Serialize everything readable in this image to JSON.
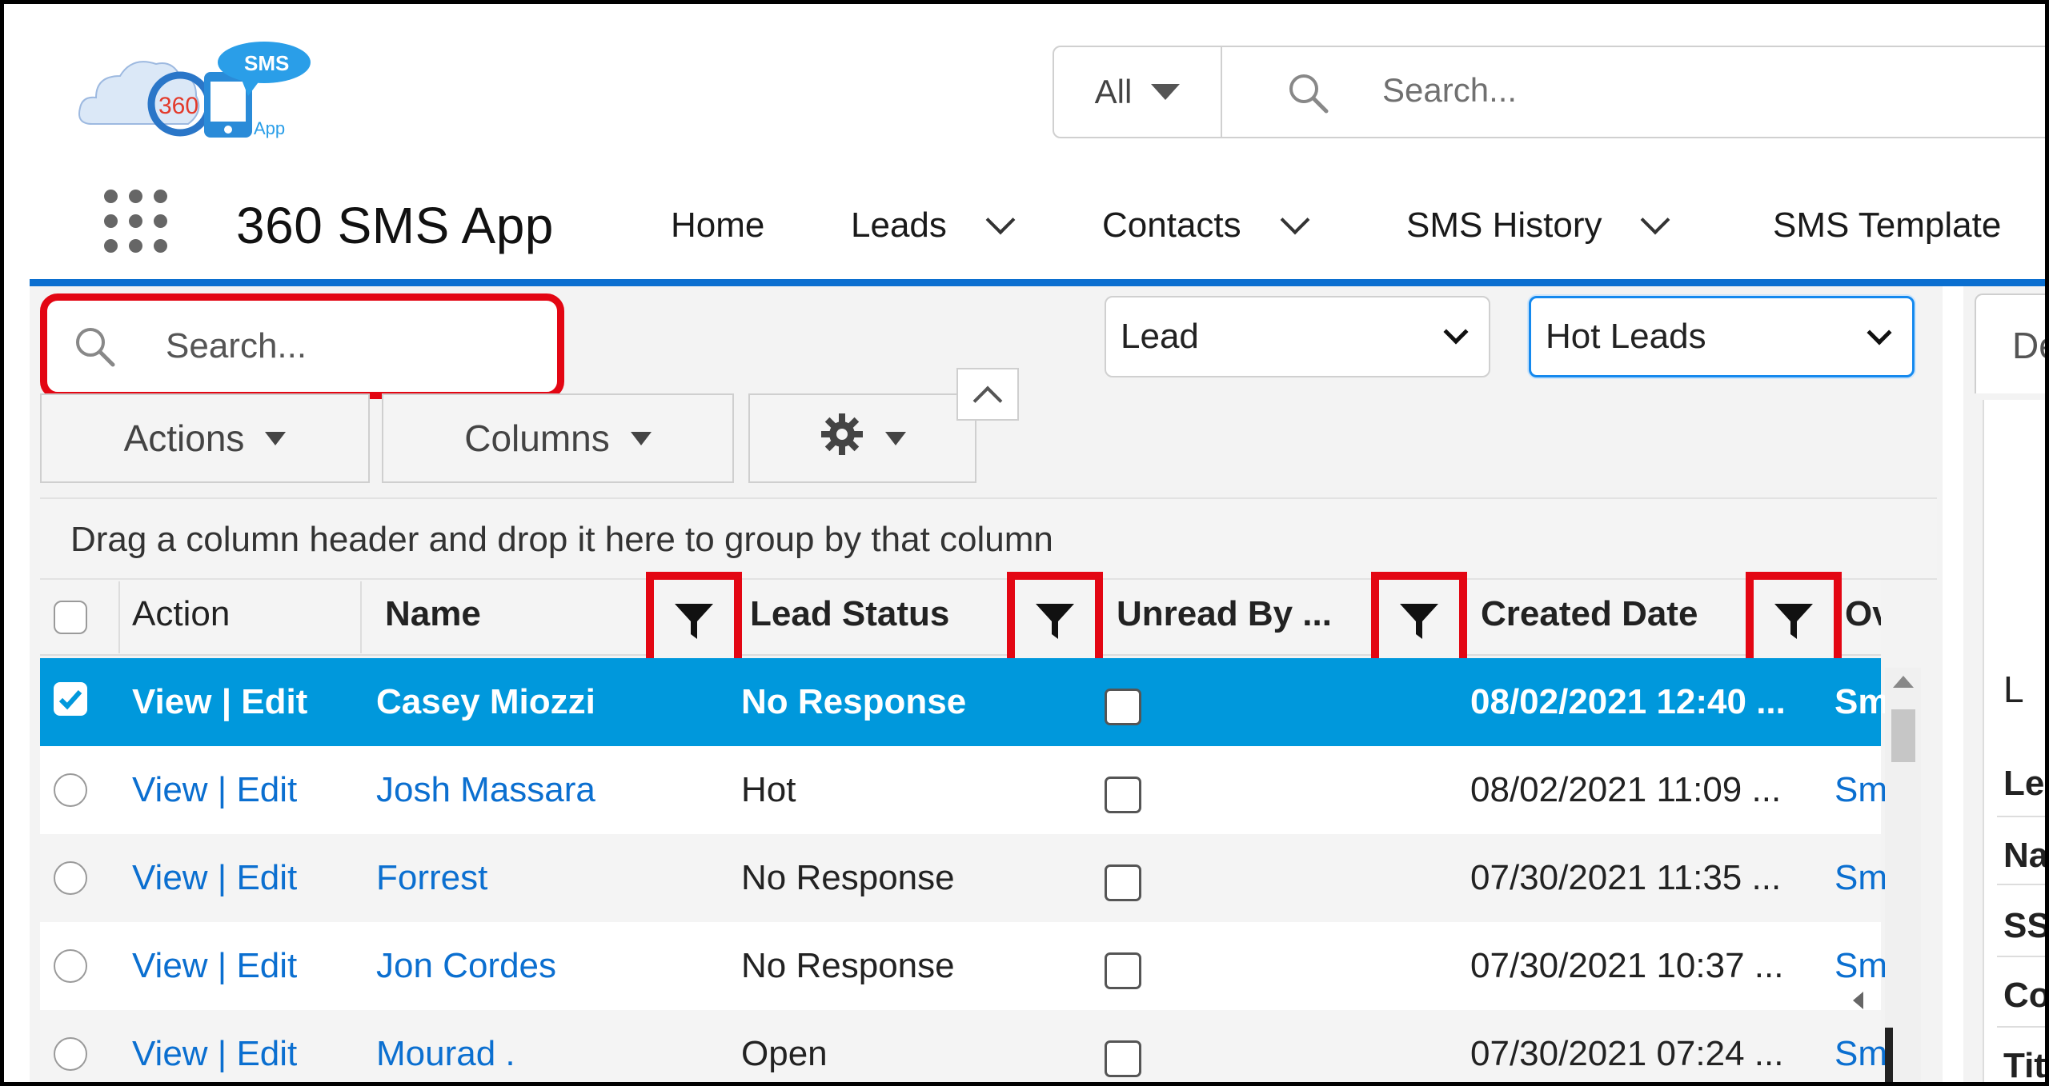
{
  "header": {
    "search_scope": "All",
    "search_placeholder": "Search...",
    "logo_text": "SMS",
    "logo_number": "360",
    "logo_sub": "App"
  },
  "nav": {
    "app_name": "360 SMS App",
    "items": [
      {
        "label": "Home",
        "has_menu": false
      },
      {
        "label": "Leads",
        "has_menu": true
      },
      {
        "label": "Contacts",
        "has_menu": true
      },
      {
        "label": "SMS History",
        "has_menu": true
      },
      {
        "label": "SMS Template",
        "has_menu": false
      }
    ]
  },
  "grid": {
    "search_placeholder": "Search...",
    "object_select": "Lead",
    "view_select": "Hot Leads",
    "toolbar": {
      "actions": "Actions",
      "columns": "Columns"
    },
    "group_hint": "Drag a column header and drop it here to group by that column",
    "columns": [
      "Action",
      "Name",
      "Lead Status",
      "Unread By ...",
      "Created Date",
      "Ov"
    ],
    "rows": [
      {
        "action": "View | Edit",
        "name": "Casey Miozzi",
        "status": "No Response",
        "created": "08/02/2021 12:40 ...",
        "owner": "Sm",
        "selected": true
      },
      {
        "action": "View | Edit",
        "name": "Josh Massara",
        "status": "Hot",
        "created": "08/02/2021 11:09 ...",
        "owner": "Sm",
        "selected": false
      },
      {
        "action": "View | Edit",
        "name": "Forrest",
        "status": "No Response",
        "created": "07/30/2021 11:35 ...",
        "owner": "Sm",
        "selected": false
      },
      {
        "action": "View | Edit",
        "name": "Jon Cordes",
        "status": "No Response",
        "created": "07/30/2021 10:37 ...",
        "owner": "Sm",
        "selected": false
      },
      {
        "action": "View | Edit",
        "name": "Mourad .",
        "status": "Open",
        "created": "07/30/2021 07:24 ...",
        "owner": "Sm",
        "selected": false
      }
    ]
  },
  "side": {
    "tab": "De",
    "heading": "L",
    "fields": [
      "Lea",
      "Na",
      "SS",
      "Co",
      "Tit"
    ]
  },
  "colors": {
    "accent": "#0b6fd0",
    "selected_row": "#0098dc",
    "highlight": "#e30613"
  }
}
